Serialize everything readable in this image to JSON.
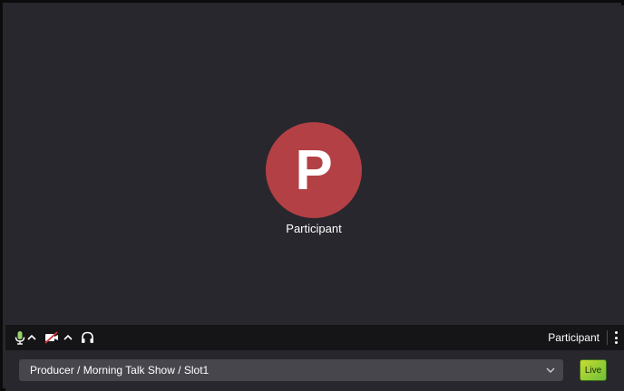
{
  "participant_tile": {
    "avatar_initial": "P",
    "avatar_color": "#b34044",
    "name": "Participant"
  },
  "toolbar": {
    "icons": [
      "microphone-icon",
      "chevron-up-icon",
      "camera-off-icon",
      "chevron-up-icon",
      "headphones-icon",
      "more-vertical-icon"
    ],
    "user_label": "Participant"
  },
  "route_selector": {
    "value": "Producer / Morning Talk Show / Slot1"
  },
  "live_button": {
    "label": "Live",
    "colors": [
      "#c8dc32",
      "#6cc038"
    ]
  }
}
